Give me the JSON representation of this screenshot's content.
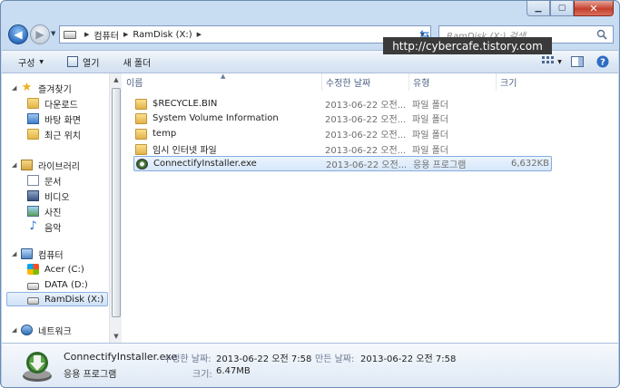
{
  "search": {
    "placeholder": "RamDisk (X:) 검색"
  },
  "watermark": "http://cybercafe.tistory.com",
  "address": {
    "crumbs": [
      "컴퓨터",
      "RamDisk (X:)"
    ]
  },
  "toolbar": {
    "organize": "구성",
    "open": "열기",
    "new_folder": "새 폴더"
  },
  "nav": {
    "favorites": "즐겨찾기",
    "favorites_items": [
      "다운로드",
      "바탕 화면",
      "최근 위치"
    ],
    "libraries": "라이브러리",
    "libraries_items": [
      "문서",
      "비디오",
      "사진",
      "음악"
    ],
    "computer": "컴퓨터",
    "computer_items": [
      "Acer (C:)",
      "DATA (D:)",
      "RamDisk (X:)"
    ],
    "network": "네트워크"
  },
  "columns": {
    "name": "이름",
    "date": "수정한 날짜",
    "type": "유형",
    "size": "크기"
  },
  "files": [
    {
      "name": "$RECYCLE.BIN",
      "date": "2013-06-22 오전...",
      "type": "파일 폴더",
      "size": ""
    },
    {
      "name": "System Volume Information",
      "date": "2013-06-22 오전...",
      "type": "파일 폴더",
      "size": ""
    },
    {
      "name": "temp",
      "date": "2013-06-22 오전...",
      "type": "파일 폴더",
      "size": ""
    },
    {
      "name": "임시 인터넷 파일",
      "date": "2013-06-22 오전...",
      "type": "파일 폴더",
      "size": ""
    },
    {
      "name": "ConnectifyInstaller.exe",
      "date": "2013-06-22 오전...",
      "type": "응용 프로그램",
      "size": "6,632KB"
    }
  ],
  "details": {
    "filename": "ConnectifyInstaller.exe",
    "filetype": "응용 프로그램",
    "modified_label": "수정한 날짜:",
    "modified_value": "2013-06-22 오전 7:58",
    "created_label": "만든 날짜:",
    "created_value": "2013-06-22 오전 7:58",
    "size_label": "크기:",
    "size_value": "6.47MB"
  }
}
